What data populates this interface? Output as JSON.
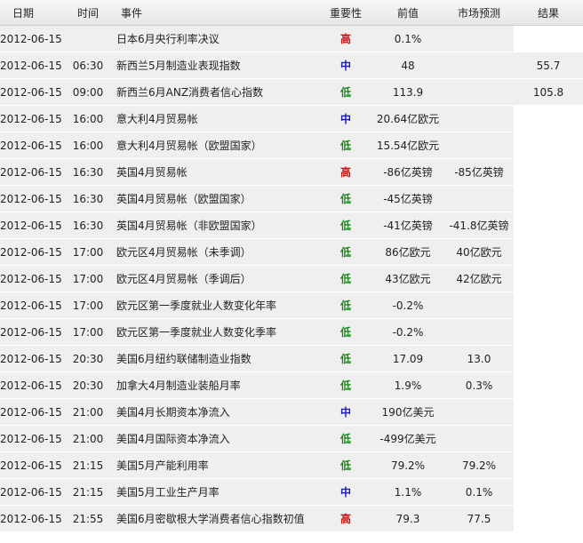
{
  "header": {
    "date": "日期",
    "time": "时间",
    "event": "事件",
    "importance": "重要性",
    "previous": "前值",
    "forecast": "市场预测",
    "result": "结果"
  },
  "colors": {
    "high": "#cc1111",
    "medium": "#1a1ab8",
    "low": "#178a17",
    "row_bg": "#efefef"
  },
  "rows": [
    {
      "date": "2012-06-15",
      "time": "",
      "event": "日本6月央行利率决议",
      "importance": "高",
      "level": "high",
      "previous": "0.1%",
      "forecast": "",
      "result": ""
    },
    {
      "date": "2012-06-15",
      "time": "06:30",
      "event": "新西兰5月制造业表现指数",
      "importance": "中",
      "level": "mid",
      "previous": "48",
      "forecast": "",
      "result": "55.7"
    },
    {
      "date": "2012-06-15",
      "time": "09:00",
      "event": "新西兰6月ANZ消费者信心指数",
      "importance": "低",
      "level": "low",
      "previous": "113.9",
      "forecast": "",
      "result": "105.8"
    },
    {
      "date": "2012-06-15",
      "time": "16:00",
      "event": "意大利4月贸易帐",
      "importance": "中",
      "level": "mid",
      "previous": "20.64亿欧元",
      "forecast": "",
      "result": ""
    },
    {
      "date": "2012-06-15",
      "time": "16:00",
      "event": "意大利4月贸易帐（欧盟国家）",
      "importance": "低",
      "level": "low",
      "previous": "15.54亿欧元",
      "forecast": "",
      "result": ""
    },
    {
      "date": "2012-06-15",
      "time": "16:30",
      "event": "英国4月贸易帐",
      "importance": "高",
      "level": "high",
      "previous": "-86亿英镑",
      "forecast": "-85亿英镑",
      "result": ""
    },
    {
      "date": "2012-06-15",
      "time": "16:30",
      "event": "英国4月贸易帐（欧盟国家）",
      "importance": "低",
      "level": "low",
      "previous": "-45亿英镑",
      "forecast": "",
      "result": ""
    },
    {
      "date": "2012-06-15",
      "time": "16:30",
      "event": "英国4月贸易帐（非欧盟国家）",
      "importance": "低",
      "level": "low",
      "previous": "-41亿英镑",
      "forecast": "-41.8亿英镑",
      "result": ""
    },
    {
      "date": "2012-06-15",
      "time": "17:00",
      "event": "欧元区4月贸易帐（未季调）",
      "importance": "低",
      "level": "low",
      "previous": "86亿欧元",
      "forecast": "40亿欧元",
      "result": ""
    },
    {
      "date": "2012-06-15",
      "time": "17:00",
      "event": "欧元区4月贸易帐（季调后）",
      "importance": "低",
      "level": "low",
      "previous": "43亿欧元",
      "forecast": "42亿欧元",
      "result": ""
    },
    {
      "date": "2012-06-15",
      "time": "17:00",
      "event": "欧元区第一季度就业人数变化年率",
      "importance": "低",
      "level": "low",
      "previous": "-0.2%",
      "forecast": "",
      "result": ""
    },
    {
      "date": "2012-06-15",
      "time": "17:00",
      "event": "欧元区第一季度就业人数变化季率",
      "importance": "低",
      "level": "low",
      "previous": "-0.2%",
      "forecast": "",
      "result": ""
    },
    {
      "date": "2012-06-15",
      "time": "20:30",
      "event": "美国6月纽约联储制造业指数",
      "importance": "低",
      "level": "low",
      "previous": "17.09",
      "forecast": "13.0",
      "result": ""
    },
    {
      "date": "2012-06-15",
      "time": "20:30",
      "event": "加拿大4月制造业装船月率",
      "importance": "低",
      "level": "low",
      "previous": "1.9%",
      "forecast": "0.3%",
      "result": ""
    },
    {
      "date": "2012-06-15",
      "time": "21:00",
      "event": "美国4月长期资本净流入",
      "importance": "中",
      "level": "mid",
      "previous": "190亿美元",
      "forecast": "",
      "result": ""
    },
    {
      "date": "2012-06-15",
      "time": "21:00",
      "event": "美国4月国际资本净流入",
      "importance": "低",
      "level": "low",
      "previous": "-499亿美元",
      "forecast": "",
      "result": ""
    },
    {
      "date": "2012-06-15",
      "time": "21:15",
      "event": "美国5月产能利用率",
      "importance": "低",
      "level": "low",
      "previous": "79.2%",
      "forecast": "79.2%",
      "result": ""
    },
    {
      "date": "2012-06-15",
      "time": "21:15",
      "event": "美国5月工业生产月率",
      "importance": "中",
      "level": "mid",
      "previous": "1.1%",
      "forecast": "0.1%",
      "result": ""
    },
    {
      "date": "2012-06-15",
      "time": "21:55",
      "event": "美国6月密歇根大学消费者信心指数初值",
      "importance": "高",
      "level": "high",
      "previous": "79.3",
      "forecast": "77.5",
      "result": ""
    }
  ]
}
